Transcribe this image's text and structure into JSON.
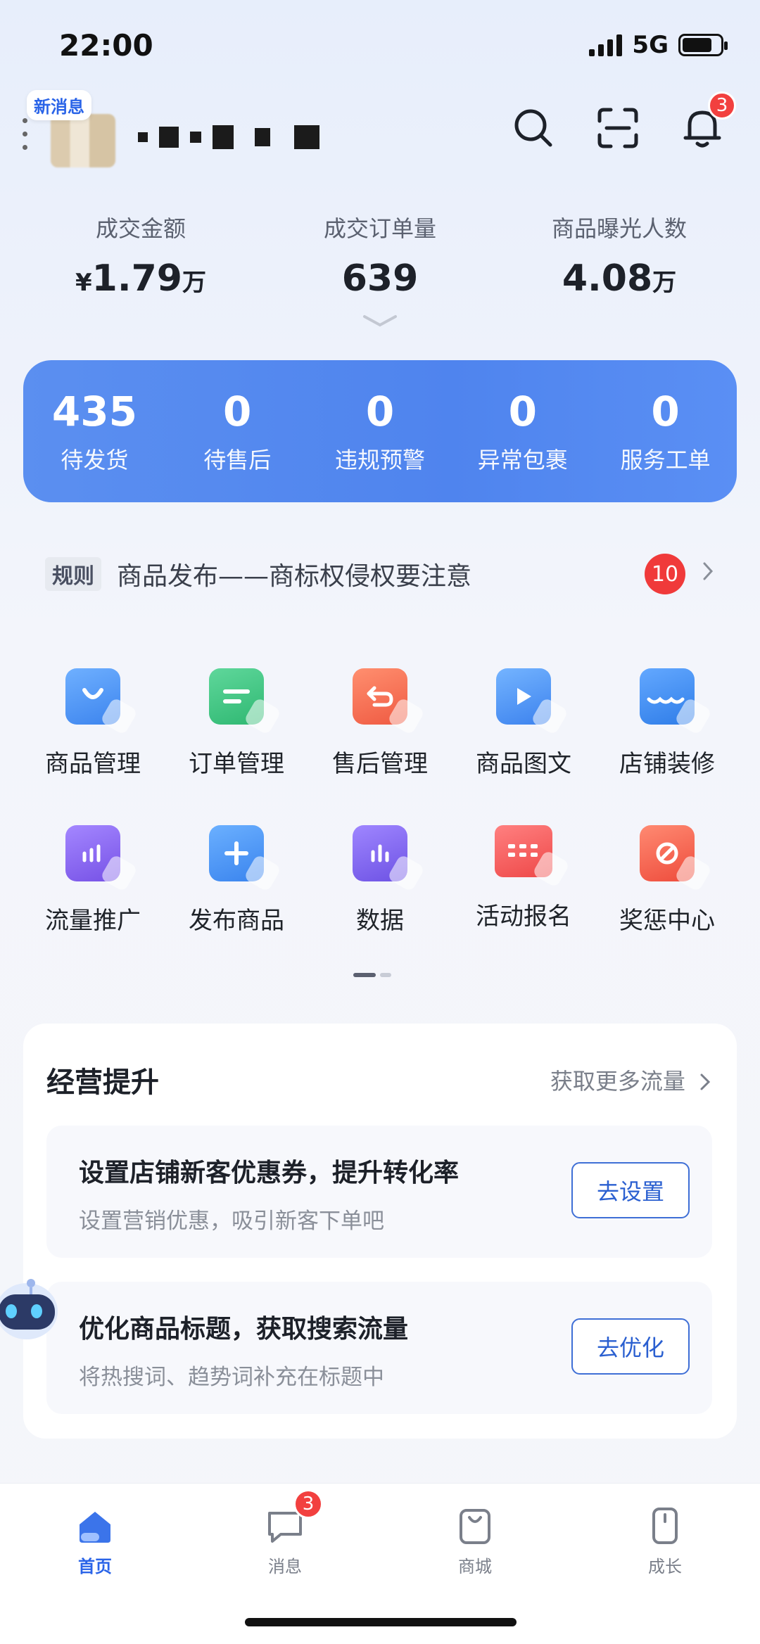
{
  "status_bar": {
    "time": "22:00",
    "network": "5G"
  },
  "header": {
    "new_message_badge": "新消息",
    "notification_count": "3"
  },
  "metrics": [
    {
      "label": "成交金额",
      "prefix": "¥",
      "value": "1.79",
      "unit": "万"
    },
    {
      "label": "成交订单量",
      "prefix": "",
      "value": "639",
      "unit": ""
    },
    {
      "label": "商品曝光人数",
      "prefix": "",
      "value": "4.08",
      "unit": "万"
    }
  ],
  "todo": [
    {
      "value": "435",
      "label": "待发货"
    },
    {
      "value": "0",
      "label": "待售后"
    },
    {
      "value": "0",
      "label": "违规预警"
    },
    {
      "value": "0",
      "label": "异常包裹"
    },
    {
      "value": "0",
      "label": "服务工单"
    }
  ],
  "rule": {
    "tag": "规则",
    "text": "商品发布——商标权侵权要注意",
    "count": "10"
  },
  "tools": [
    {
      "label": "商品管理",
      "icon": "bag-icon",
      "color": "#4a90f0"
    },
    {
      "label": "订单管理",
      "icon": "order-icon",
      "color": "#34c17a"
    },
    {
      "label": "售后管理",
      "icon": "return-icon",
      "color": "#f06a4c"
    },
    {
      "label": "商品图文",
      "icon": "media-icon",
      "color": "#4a8ef2"
    },
    {
      "label": "店铺装修",
      "icon": "store-icon",
      "color": "#3a86ee"
    },
    {
      "label": "流量推广",
      "icon": "traffic-icon",
      "color": "#8b63ec"
    },
    {
      "label": "发布商品",
      "icon": "plus-icon",
      "color": "#3f8cf0"
    },
    {
      "label": "数据",
      "icon": "chart-icon",
      "color": "#8062ea"
    },
    {
      "label": "活动报名",
      "icon": "calendar-icon",
      "color": "#f05a5a"
    },
    {
      "label": "奖惩中心",
      "icon": "ban-icon",
      "color": "#f05a4a"
    }
  ],
  "business": {
    "title": "经营提升",
    "more": "获取更多流量",
    "tasks": [
      {
        "title": "设置店铺新客优惠券，提升转化率",
        "subtitle": "设置营销优惠，吸引新客下单吧",
        "button": "去设置"
      },
      {
        "title": "优化商品标题，获取搜索流量",
        "subtitle": "将热搜词、趋势词补充在标题中",
        "button": "去优化"
      }
    ]
  },
  "tabbar": [
    {
      "label": "首页"
    },
    {
      "label": "消息",
      "badge": "3"
    },
    {
      "label": "商城"
    },
    {
      "label": "成长"
    }
  ],
  "colors": {
    "accent": "#2a64e8",
    "card_blue": "#4f84ee",
    "badge_red": "#f2403f"
  }
}
